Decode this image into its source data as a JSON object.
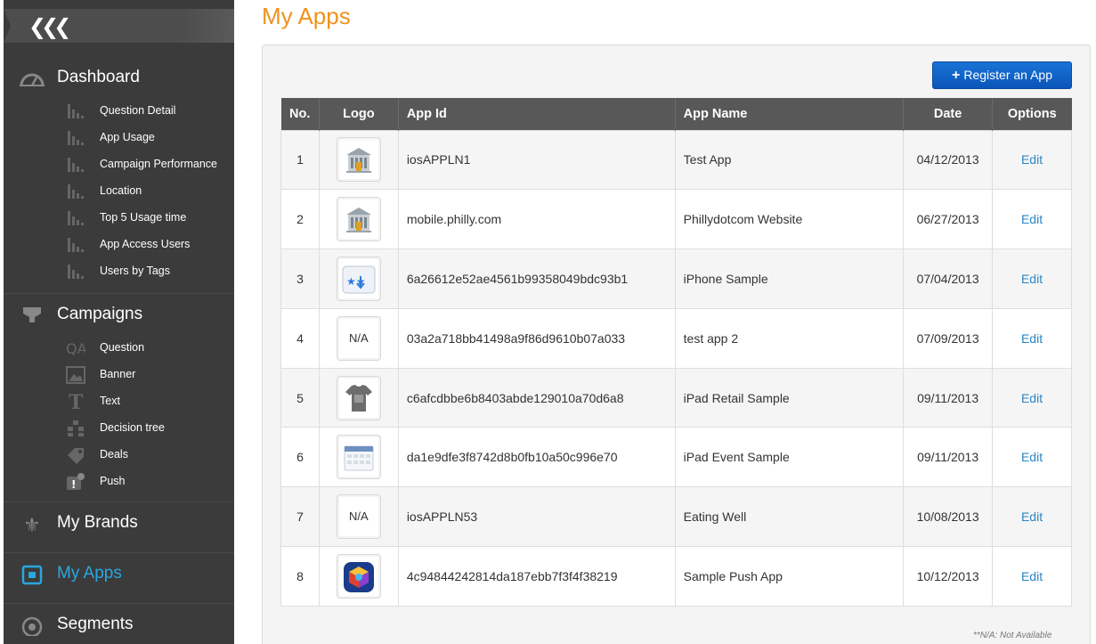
{
  "sidebar": {
    "dashboard": {
      "label": "Dashboard",
      "items": [
        "Question Detail",
        "App Usage",
        "Campaign Performance",
        "Location",
        "Top 5 Usage time",
        "App Access Users",
        "Users by Tags"
      ]
    },
    "campaigns": {
      "label": "Campaigns",
      "items": [
        "Question",
        "Banner",
        "Text",
        "Decision tree",
        "Deals",
        "Push"
      ]
    },
    "my_brands": "My Brands",
    "my_apps": "My Apps",
    "segments": "Segments"
  },
  "page": {
    "title": "My Apps",
    "register_button": "Register an App",
    "footnote": "**N/A: Not Available"
  },
  "table": {
    "headers": [
      "No.",
      "Logo",
      "App Id",
      "App Name",
      "Date",
      "Options"
    ],
    "rows": [
      {
        "no": "1",
        "logo": "building-icon",
        "app_id": "iosAPPLN1",
        "app_name": "Test App",
        "date": "04/12/2013",
        "option": "Edit"
      },
      {
        "no": "2",
        "logo": "building-icon",
        "app_id": "mobile.philly.com",
        "app_name": "Phillydotcom Website",
        "date": "06/27/2013",
        "option": "Edit"
      },
      {
        "no": "3",
        "logo": "stars-app-icon",
        "app_id": "6a26612e52ae4561b99358049bdc93b1",
        "app_name": "iPhone Sample",
        "date": "07/04/2013",
        "option": "Edit"
      },
      {
        "no": "4",
        "logo": "N/A",
        "app_id": "03a2a718bb41498a9f86d9610b07a033",
        "app_name": "test app 2",
        "date": "07/09/2013",
        "option": "Edit"
      },
      {
        "no": "5",
        "logo": "tshirt-icon",
        "app_id": "c6afcdbbe6b8403abde129010a70d6a8",
        "app_name": "iPad Retail Sample",
        "date": "09/11/2013",
        "option": "Edit"
      },
      {
        "no": "6",
        "logo": "calendar-icon",
        "app_id": "da1e9dfe3f8742d8b0fb10a50c996e70",
        "app_name": "iPad Event Sample",
        "date": "09/11/2013",
        "option": "Edit"
      },
      {
        "no": "7",
        "logo": "N/A",
        "app_id": "iosAPPLN53",
        "app_name": "Eating Well",
        "date": "10/08/2013",
        "option": "Edit"
      },
      {
        "no": "8",
        "logo": "colorful-cube-icon",
        "app_id": "4c94844242814da187ebb7f3f4f38219",
        "app_name": "Sample Push App",
        "date": "10/12/2013",
        "option": "Edit"
      }
    ]
  },
  "colors": {
    "accent_orange": "#f0921e",
    "active_blue": "#2aa7e0",
    "link_blue": "#2a85c5",
    "button_blue": "#0a64c8"
  }
}
